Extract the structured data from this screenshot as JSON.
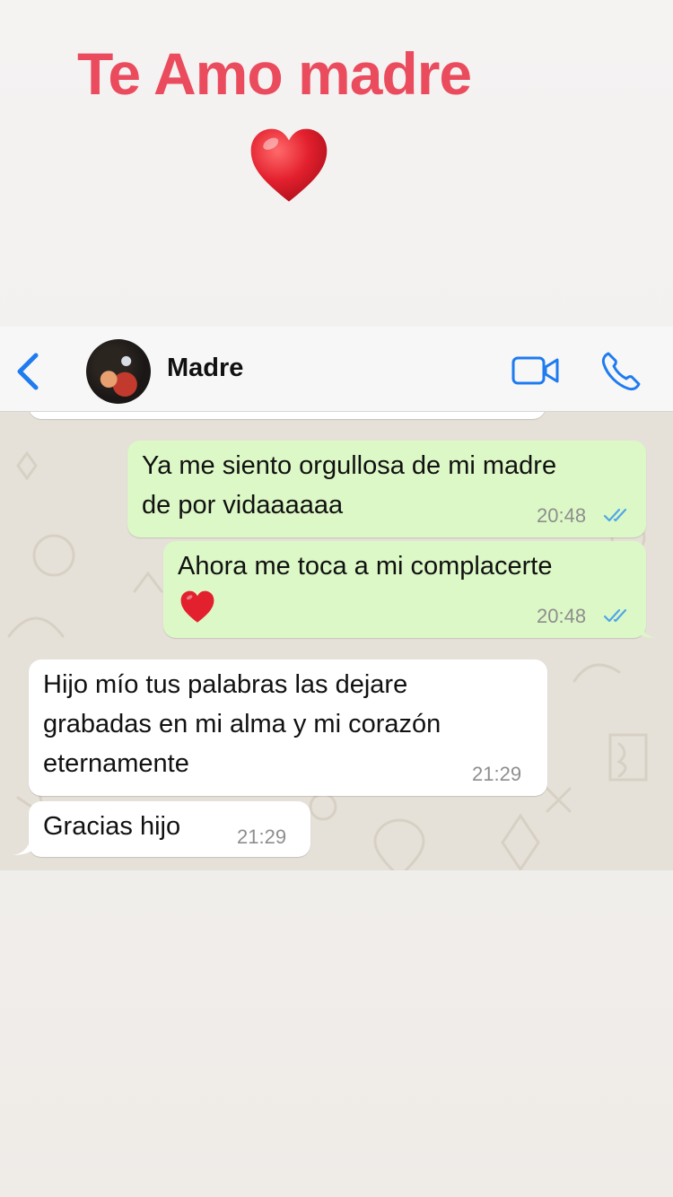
{
  "story": {
    "title": "Te Amo madre",
    "heart_color": "#e3202e"
  },
  "header": {
    "back_icon": "chevron-left-icon",
    "contact_name": "Madre",
    "video_icon": "video-camera-icon",
    "call_icon": "phone-icon",
    "accent": "#1e7bf0"
  },
  "messages": [
    {
      "direction": "outgoing",
      "lines": [
        "Ya me siento orgullosa de mi madre",
        "de por vidaaaaaa"
      ],
      "time": "20:48",
      "status": "read"
    },
    {
      "direction": "outgoing",
      "lines": [
        "Ahora me toca a mi complacerte"
      ],
      "emoji": "red-heart",
      "time": "20:48",
      "status": "read"
    },
    {
      "direction": "incoming",
      "lines": [
        "Hijo mío tus palabras las dejare",
        "grabadas en mi alma y mi corazón",
        "eternamente"
      ],
      "time": "21:29"
    },
    {
      "direction": "incoming",
      "lines": [
        "Gracias hijo"
      ],
      "time": "21:29"
    }
  ],
  "colors": {
    "outgoing_bubble": "#dcf8c6",
    "incoming_bubble": "#ffffff",
    "read_ticks": "#4fa6e8",
    "title_color": "#ea4c5e"
  }
}
